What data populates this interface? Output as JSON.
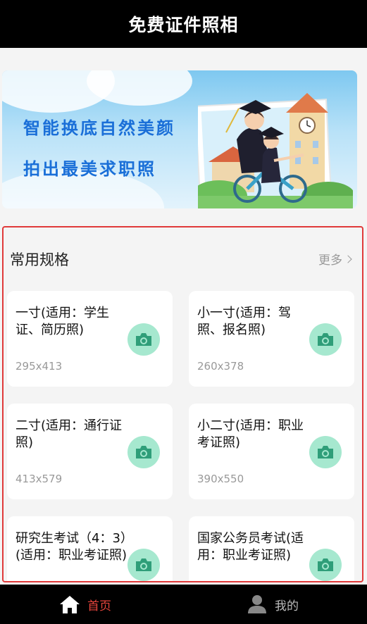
{
  "header": {
    "title": "免费证件照相"
  },
  "banner": {
    "line1": "智能换底自然美颜",
    "line2": "拍出最美求职照"
  },
  "section": {
    "title": "常用规格",
    "more_label": "更多"
  },
  "cards": [
    {
      "title": "一寸(适用：学生证、简历照)",
      "size": "295x413"
    },
    {
      "title": "小一寸(适用：驾照、报名照)",
      "size": "260x378"
    },
    {
      "title": "二寸(适用：通行证照)",
      "size": "413x579"
    },
    {
      "title": "小二寸(适用：职业考证照)",
      "size": "390x550"
    },
    {
      "title": "研究生考试（4：3）(适用：职业考证照)",
      "size": ""
    },
    {
      "title": "国家公务员考试(适用：职业考证照)",
      "size": ""
    }
  ],
  "tabbar": {
    "home_label": "首页",
    "mine_label": "我的"
  },
  "colors": {
    "active_tab": "#e8453c",
    "inactive_tab": "#bbbbbb",
    "camera_bg": "#a6e8cf",
    "camera_icon": "#2f9e79",
    "banner_text": "#1a6fd8",
    "highlight_border": "#e03a3a"
  },
  "icons": {
    "home": "home-icon",
    "mine": "person-icon",
    "camera": "camera-icon",
    "more": "chevron-right-icon"
  }
}
